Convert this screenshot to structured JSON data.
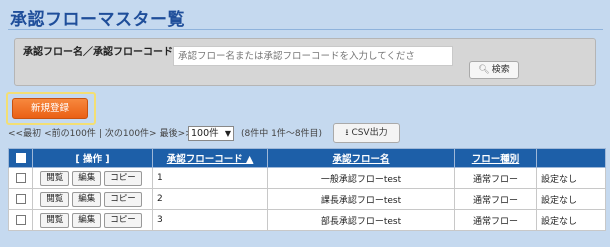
{
  "page": {
    "title": "承認フローマスター覧"
  },
  "search": {
    "label": "承認フロー名／承認フローコード",
    "placeholder": "承認フロー名または承認フローコードを入力してくださ",
    "button_label": "検索"
  },
  "actions": {
    "new_label": "新規登録",
    "csv_label": "CSV出力"
  },
  "pager": {
    "first": "<<最初",
    "prev": "<前の100件",
    "separator": "|",
    "next": "次の100件>",
    "last": "最後>>",
    "per_page": "100件",
    "count_text": "(8件中 1件～8件目)"
  },
  "table": {
    "headers": {
      "ops": "[ 操作 ]",
      "code": "承認フローコード ▲",
      "name": "承認フロー名",
      "type": "フロー種別"
    },
    "row_buttons": {
      "view": "閲覧",
      "edit": "編集",
      "copy": "コピー"
    },
    "rows": [
      {
        "code": "1",
        "name": "一般承認フローtest",
        "type": "通常フロー",
        "setting": "設定なし"
      },
      {
        "code": "2",
        "name": "課長承認フローtest",
        "type": "通常フロー",
        "setting": "設定なし"
      },
      {
        "code": "3",
        "name": "部長承認フローtest",
        "type": "通常フロー",
        "setting": "設定なし"
      }
    ]
  },
  "colors": {
    "title": "#1f4e9a",
    "header_bg": "#1d5fa8",
    "new_button": "#ea6014",
    "background": "#c5d9ef"
  },
  "icons": {
    "search": "magnifier-icon",
    "csv": "download-icon"
  }
}
